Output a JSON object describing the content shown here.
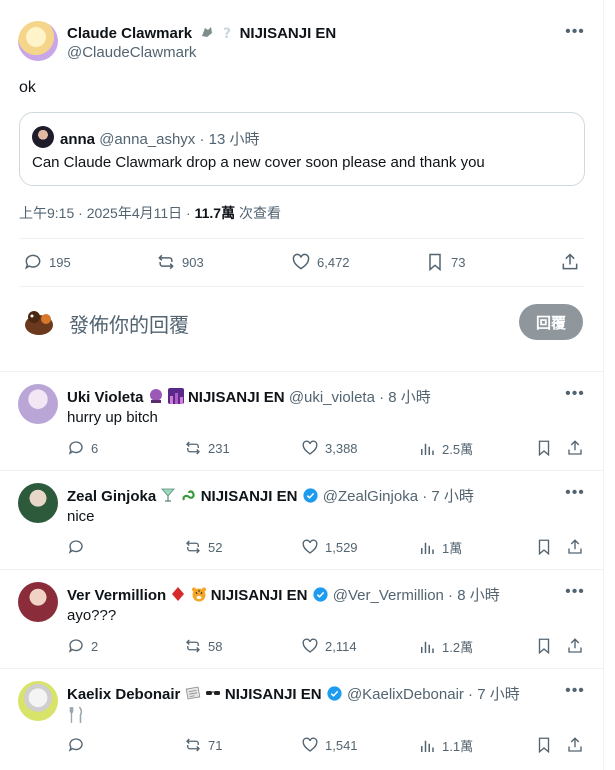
{
  "post": {
    "display_name": "Claude Clawmark",
    "affiliation": "NIJISANJI EN",
    "handle": "@ClaudeClawmark",
    "text": "ok",
    "quote": {
      "name": "anna",
      "handle_time": "@anna_ashyx · 13 小時",
      "text": "Can Claude Clawmark drop a new cover soon please and thank you"
    },
    "timestamp": "上午9:15 · 2025年4月11日 · ",
    "views_count": "11.7萬",
    "views_label": " 次查看",
    "actions": {
      "replies": "195",
      "reposts": "903",
      "likes": "6,472",
      "bookmarks": "73"
    }
  },
  "compose": {
    "placeholder": "發佈你的回覆",
    "button_label": "回覆"
  },
  "replies": [
    {
      "name": "Uki Violeta",
      "affiliation": "NIJISANJI EN",
      "handle_time": "@uki_violeta · 8 小時",
      "text": "hurry up bitch",
      "replies": "6",
      "reposts": "231",
      "likes": "3,388",
      "views": "2.5萬",
      "avatar_color": "#b9a6d6"
    },
    {
      "name": "Zeal Ginjoka",
      "affiliation": "NIJISANJI EN",
      "handle_time": "@ZealGinjoka · 7 小時",
      "text": "nice",
      "replies": "",
      "reposts": "52",
      "likes": "1,529",
      "views": "1萬",
      "avatar_color": "#2d5a3a"
    },
    {
      "name": "Ver Vermillion",
      "affiliation": "NIJISANJI EN",
      "handle_time": "@Ver_Vermillion · 8 小時",
      "text": "ayo???",
      "replies": "2",
      "reposts": "58",
      "likes": "2,114",
      "views": "1.2萬",
      "avatar_color": "#8a2c3a"
    },
    {
      "name": "Kaelix Debonair",
      "affiliation": "NIJISANJI EN",
      "handle_time": "@KaelixDebonair · 7 小時",
      "text": "",
      "replies": "",
      "reposts": "71",
      "likes": "1,541",
      "views": "1.1萬",
      "avatar_color": "#d8e36a"
    }
  ]
}
